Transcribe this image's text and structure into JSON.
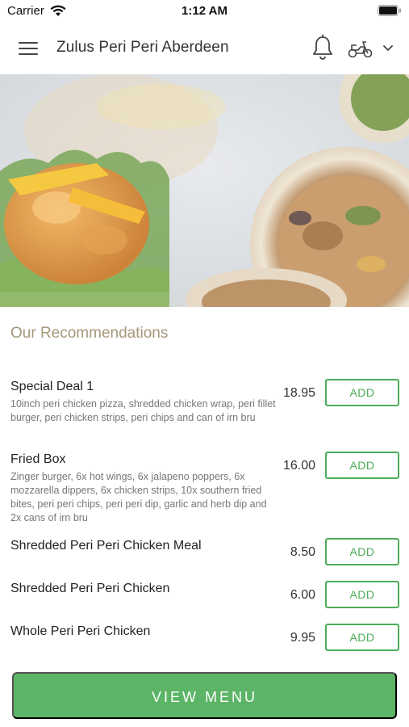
{
  "status_bar": {
    "carrier": "Carrier",
    "time": "1:12 AM"
  },
  "header": {
    "title": "Zulus Peri Peri Aberdeen"
  },
  "icons": {
    "menu": "hamburger-icon",
    "notifications": "bell-icon",
    "delivery": "scooter-icon",
    "dropdown": "chevron-down-icon"
  },
  "recommendations": {
    "title": "Our Recommendations",
    "add_label": "ADD",
    "items": [
      {
        "name": "Special Deal 1",
        "description": "10inch peri chicken pizza, shredded chicken wrap, peri fillet burger, peri chicken strips, peri chips  and can of irn bru",
        "price": "18.95"
      },
      {
        "name": "Fried Box",
        "description": "Zinger burger, 6x hot wings, 6x jalapeno poppers, 6x mozzarella dippers, 6x chicken strips, 10x southern fried bites, peri peri chips, peri peri dip, garlic and herb dip and 2x cans of irn bru",
        "price": "16.00"
      },
      {
        "name": "Shredded Peri Peri Chicken Meal",
        "description": "",
        "price": "8.50"
      },
      {
        "name": "Shredded Peri Peri Chicken",
        "description": "",
        "price": "6.00"
      },
      {
        "name": "Whole Peri Peri Chicken",
        "description": "",
        "price": "9.95"
      }
    ]
  },
  "footer": {
    "view_menu_label": "VIEW MENU"
  },
  "colors": {
    "accent_green": "#5cb466",
    "section_title": "#a6977a",
    "add_border": "#4cac58"
  }
}
